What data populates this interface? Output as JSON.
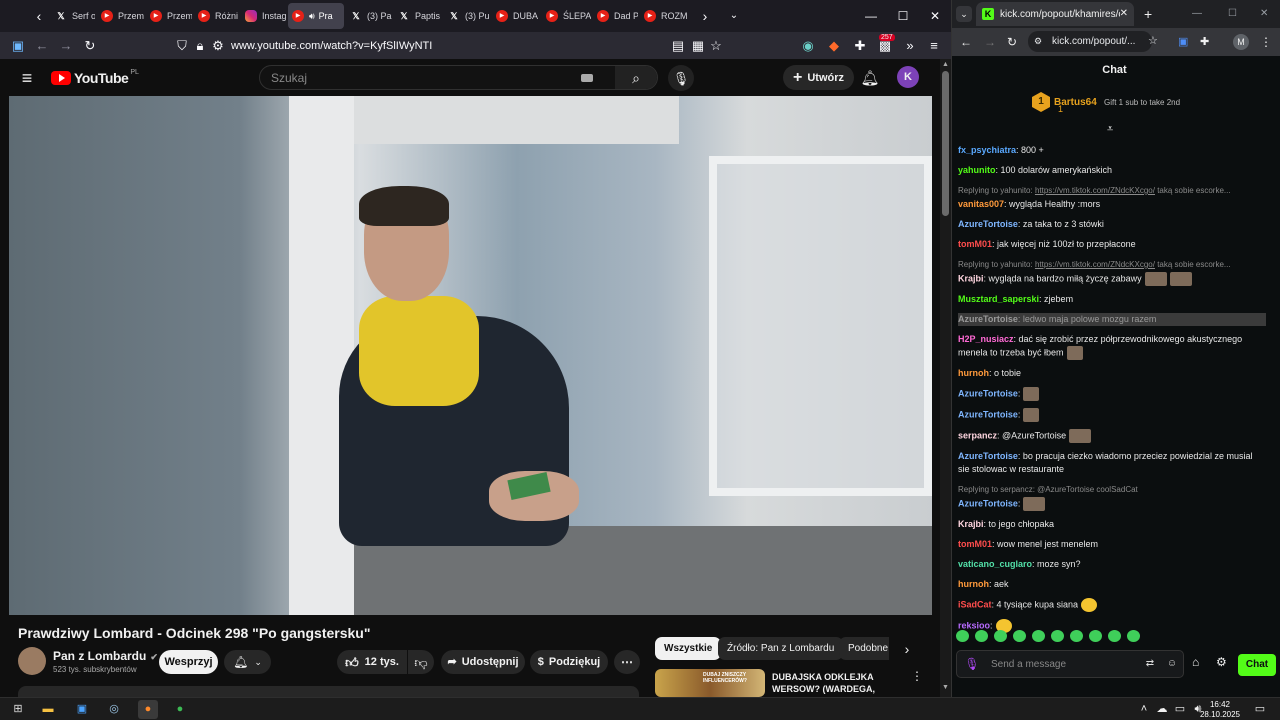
{
  "browser": {
    "tabs": [
      {
        "label": "Serf o",
        "icon": "x-icon"
      },
      {
        "label": "Przem",
        "icon": "youtube-icon"
      },
      {
        "label": "Przem",
        "icon": "youtube-icon"
      },
      {
        "label": "Różni",
        "icon": "youtube-icon"
      },
      {
        "label": "Instag",
        "icon": "instagram-icon"
      },
      {
        "label": "Pra",
        "icon": "youtube-icon"
      },
      {
        "label": "(3) Pa",
        "icon": "x-icon"
      },
      {
        "label": "Paptis",
        "icon": "x-icon"
      },
      {
        "label": "(3) Pu",
        "icon": "x-icon"
      },
      {
        "label": "DUBA",
        "icon": "youtube-icon"
      },
      {
        "label": "ŚLEPA",
        "icon": "youtube-icon"
      },
      {
        "label": "Dad P",
        "icon": "youtube-icon"
      },
      {
        "label": "ROZM",
        "icon": "youtube-icon"
      }
    ],
    "url": "www.youtube.com/watch?v=KyfSlIWyNTI",
    "ext_badge": "257"
  },
  "youtube": {
    "logo_text": "YouTube",
    "logo_country": "PL",
    "search_placeholder": "Szukaj",
    "create_label": "Utwórz",
    "avatar_letter": "K",
    "video_title": "Prawdziwy Lombard - Odcinek 298 \"Po gangstersku\"",
    "channel_name": "Pan z Lombardu",
    "subscribers": "523 tys. subskrybentów",
    "support_label": "Wesprzyj",
    "likes": "12 tys.",
    "share_label": "Udostępnij",
    "thanks_label": "Podziękuj",
    "chips": [
      "Wszystkie",
      "Źródło: Pan z Lombardu",
      "Podobne"
    ],
    "rec_title": "DUBAJSKA ODKLEJKA WERSOW? (WARDEGA, NITRO",
    "rec_thumb_text": "DUBAJ ZNISZCZY INFLUENCERÓW?"
  },
  "kick": {
    "tab_title": "kick.com/popout/khamires/cha",
    "url": "kick.com/popout/...",
    "profile_letter": "M",
    "chat_title": "Chat",
    "pinned_user": "Bartus64",
    "pinned_rank": "1",
    "pinned_count": "1",
    "gift_text": "Gift 1 sub to take 2nd",
    "messages": [
      {
        "user": "fx_psychiatra",
        "color": "#5aa9ff",
        "text": ": 800 +"
      },
      {
        "user": "yahunito",
        "color": "#53fc18",
        "text": ": 100 dolarów amerykańskich"
      },
      {
        "reply_prefix": "Replying to yahunito: ",
        "reply_link": "https://vm.tiktok.com/ZNdcKXcgo/",
        "reply_rest": " taką sobie escorke..."
      },
      {
        "user": "vanitas007",
        "color": "#ff9a3c",
        "text": ": wygląda Healthy :mors"
      },
      {
        "user": "AzureTortoise",
        "color": "#7fb6ff",
        "text": ": za taka to z 3 stówki"
      },
      {
        "user": "tomM01",
        "color": "#ff4d4d",
        "text": ": jak więcej niż 100zł to przepłacone"
      },
      {
        "reply_prefix": "Replying to yahunito: ",
        "reply_link": "https://vm.tiktok.com/ZNdcKXcgo/",
        "reply_rest": " taką sobie escorke..."
      },
      {
        "user": "Krajbi",
        "color": "#ffd6e0",
        "text": ": wygląda na bardzo miłą życzę zabawy"
      },
      {
        "user": "Musztard_saperski",
        "color": "#53fc18",
        "text": ": zjebem"
      },
      {
        "user": "AzureTortoise",
        "color": "#999999",
        "text": ": ledwo maja polowe mozgu razem",
        "highlight": true
      },
      {
        "user": "H2P_nusiacz",
        "color": "#ff6ad5",
        "text": ": dać się zrobić przez półprzewodnikowego akustycznego menela to trzeba być łbem"
      },
      {
        "user": "hurnoh",
        "color": "#ff9a3c",
        "text": ": o tobie"
      },
      {
        "user": "AzureTortoise",
        "color": "#7fb6ff",
        "text": ":"
      },
      {
        "user": "AzureTortoise",
        "color": "#7fb6ff",
        "text": ":"
      },
      {
        "user": "serpancz",
        "color": "#ffd6e0",
        "text": ": @AzureTortoise"
      },
      {
        "user": "AzureTortoise",
        "color": "#7fb6ff",
        "text": ": bo pracuja ciezko wiadomo przeciez powiedzial ze musial sie stolowac w restaurante"
      },
      {
        "reply_prefix": "Replying to serpancz: ",
        "reply_link": "",
        "reply_rest": "@AzureTortoise coolSadCat"
      },
      {
        "user": "AzureTortoise",
        "color": "#7fb6ff",
        "text": ":"
      },
      {
        "user": "Krajbi",
        "color": "#ffd6e0",
        "text": ": to jego chłopaka"
      },
      {
        "user": "tomM01",
        "color": "#ff4d4d",
        "text": ": wow menel jest menelem"
      },
      {
        "user": "vaticano_cuglaro",
        "color": "#53e0a8",
        "text": ": moze syn?"
      },
      {
        "user": "hurnoh",
        "color": "#ff9a3c",
        "text": ": aek"
      },
      {
        "user": "iSadCat",
        "color": "#ff4d4d",
        "text": ": 4 tysiące kupa siana"
      },
      {
        "user": "reksioo",
        "color": "#b86bff",
        "text": ":"
      }
    ],
    "input_placeholder": "Send a message",
    "chat_button": "Chat"
  },
  "taskbar": {
    "time": "16:42",
    "date": "28.10.2025"
  }
}
